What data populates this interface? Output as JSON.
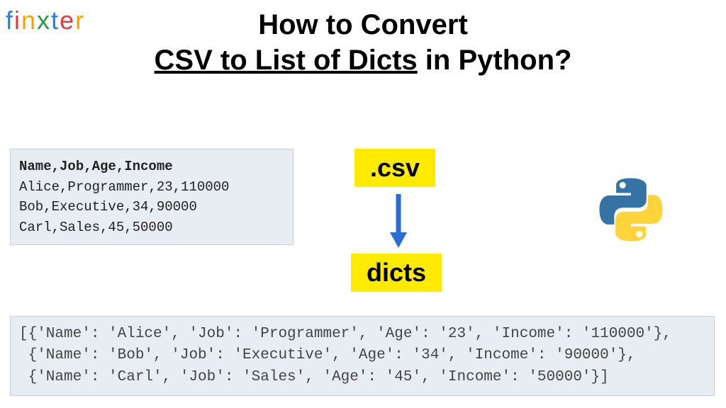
{
  "logo": "finxter",
  "heading": {
    "line1": "How to Convert",
    "underlined": "CSV to List of Dicts",
    "line2_suffix": " in Python?"
  },
  "csv": {
    "header": "Name,Job,Age,Income",
    "rows": [
      "Alice,Programmer,23,110000",
      "Bob,Executive,34,90000",
      "Carl,Sales,45,50000"
    ]
  },
  "labels": {
    "csv": ".csv",
    "dicts": "dicts"
  },
  "output": "[{'Name': 'Alice', 'Job': 'Programmer', 'Age': '23', 'Income': '110000'},\n {'Name': 'Bob', 'Job': 'Executive', 'Age': '34', 'Income': '90000'},\n {'Name': 'Carl', 'Job': 'Sales', 'Age': '45', 'Income': '50000'}]"
}
